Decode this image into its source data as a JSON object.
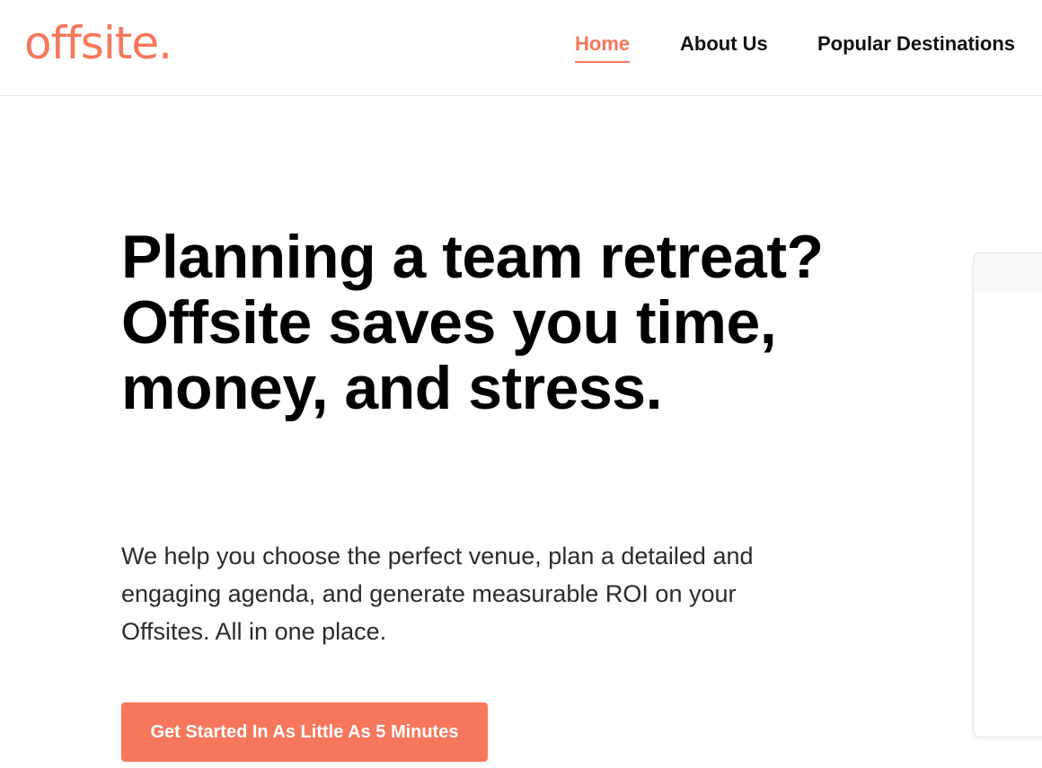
{
  "brand": {
    "logo_text": "offsite.",
    "accent_color": "#f6775b"
  },
  "nav": {
    "items": [
      {
        "label": "Home",
        "active": true
      },
      {
        "label": "About Us",
        "active": false
      },
      {
        "label": "Popular Destinations",
        "active": false
      }
    ]
  },
  "hero": {
    "title": "Planning a team retreat? Offsite saves you time, money, and stress.",
    "subtitle": "We help you choose the perfect venue, plan a detailed and engaging agenda, and generate measurable ROI on your Offsites. All in one place.",
    "cta_label": "Get Started In As Little As 5 Minutes"
  }
}
